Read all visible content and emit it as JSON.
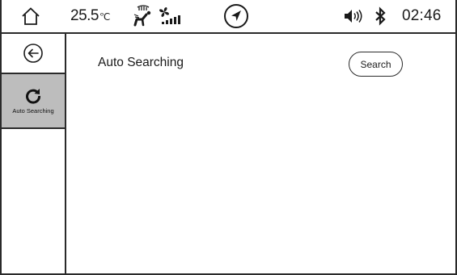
{
  "status_bar": {
    "home_icon": "home-icon",
    "temperature": "25.5",
    "temperature_unit": "℃",
    "airflow_icon": "airflow-direction-icon",
    "fan_icon": "fan-speed-icon",
    "navigation_icon": "navigation-arrow-icon",
    "volume_icon": "volume-icon",
    "bluetooth_icon": "bluetooth-icon",
    "time": "02:46"
  },
  "sidebar": {
    "back_icon": "back-arrow-icon",
    "items": [
      {
        "label": "Auto Searching",
        "icon": "refresh-icon",
        "selected": true
      }
    ]
  },
  "main": {
    "title": "Auto Searching",
    "search_button_label": "Search"
  },
  "colors": {
    "line": "#2a2a2a",
    "selected_tab_bg": "#bdbdbd",
    "background": "#ffffff"
  }
}
